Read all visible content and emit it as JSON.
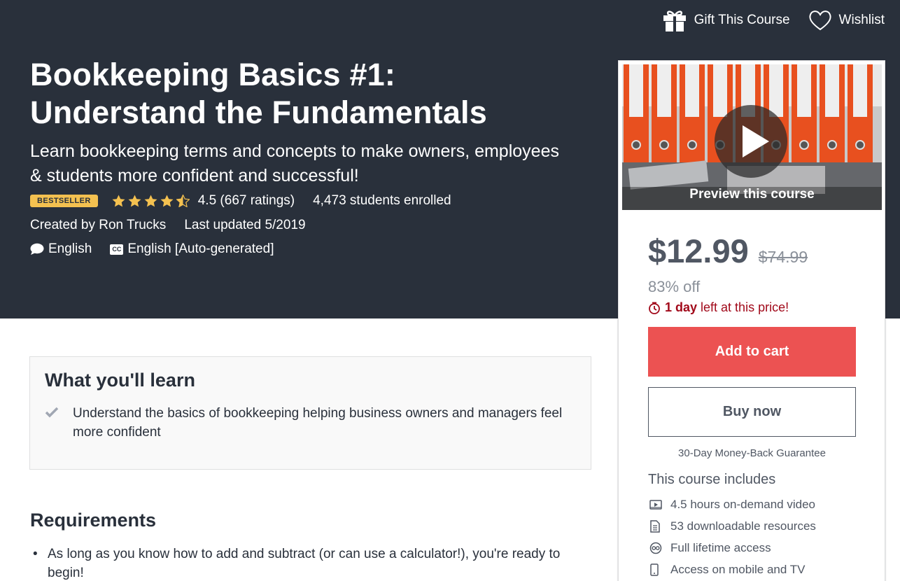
{
  "header": {
    "gift_label": "Gift This Course",
    "wishlist_label": "Wishlist"
  },
  "course": {
    "title_line1": "Bookkeeping Basics #1:",
    "title_line2": "Understand the Fundamentals",
    "subtitle": "Learn bookkeeping terms and concepts to make owners, employees & students more confident and successful!",
    "badge": "BESTSELLER",
    "rating": 4.5,
    "rating_text": "4.5 (667 ratings)",
    "enrolled": "4,473 students enrolled",
    "created_by": "Created by Ron Trucks",
    "last_updated": "Last updated 5/2019",
    "language": "English",
    "captions_icon_text": "CC",
    "captions": "English [Auto-generated]"
  },
  "learn": {
    "title": "What you'll learn",
    "items": [
      "Understand the basics of bookkeeping helping business owners and managers feel more confident"
    ]
  },
  "requirements": {
    "title": "Requirements",
    "items": [
      "As long as you know how to add and subtract (or can use a calculator!), you're ready to begin!"
    ]
  },
  "sidebar": {
    "preview_label": "Preview this course",
    "price": "$12.99",
    "original_price": "$74.99",
    "discount": "83% off",
    "timer_bold": "1 day",
    "timer_rest": " left at this price!",
    "add_to_cart": "Add to cart",
    "buy_now": "Buy now",
    "guarantee": "30-Day Money-Back Guarantee",
    "includes_title": "This course includes",
    "includes": [
      {
        "icon": "video-icon",
        "label": "4.5 hours on-demand video"
      },
      {
        "icon": "file-icon",
        "label": "53 downloadable resources"
      },
      {
        "icon": "infinity-icon",
        "label": "Full lifetime access"
      },
      {
        "icon": "mobile-icon",
        "label": "Access on mobile and TV"
      }
    ]
  },
  "colors": {
    "hero_bg": "#29303b",
    "accent_red": "#ec5252",
    "badge_yellow": "#f4c150",
    "timer_red": "#a1091a"
  }
}
